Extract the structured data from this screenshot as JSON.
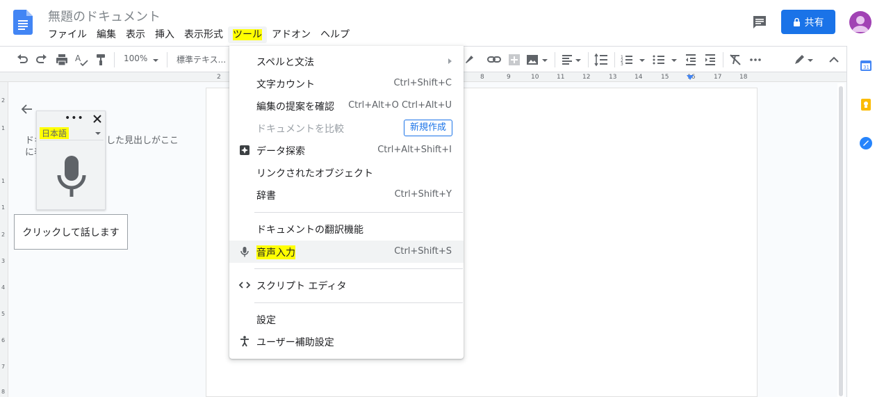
{
  "document": {
    "title": "無題のドキュメント"
  },
  "menubar": {
    "items": [
      "ファイル",
      "編集",
      "表示",
      "挿入",
      "表示形式",
      "ツール",
      "アドオン",
      "ヘルプ"
    ]
  },
  "header": {
    "share_label": "共有"
  },
  "toolbar": {
    "zoom": "100%",
    "style": "標準テキス..."
  },
  "ruler": {
    "marks": [
      "2",
      "8",
      "9",
      "10",
      "11",
      "12",
      "13",
      "14",
      "15",
      "16",
      "17",
      "18"
    ],
    "v_marks": [
      "2",
      "1",
      "1",
      "1",
      "2",
      "3",
      "4",
      "5",
      "6",
      "7",
      "8"
    ]
  },
  "outline": {
    "text_line1": "ドキュメントに追加した見出しがここ",
    "text_line2": "に表示されます。"
  },
  "voice_widget": {
    "language": "日本語",
    "dots": "•••",
    "tooltip": "クリックして話します"
  },
  "tools_menu": {
    "items": [
      {
        "label": "スペルと文法",
        "shortcut": ""
      },
      {
        "label": "文字カウント",
        "shortcut": "Ctrl+Shift+C"
      },
      {
        "label": "編集の提案を確認",
        "shortcut": "Ctrl+Alt+O Ctrl+Alt+U"
      },
      {
        "label": "ドキュメントを比較",
        "shortcut": ""
      },
      {
        "label": "データ探索",
        "shortcut": "Ctrl+Alt+Shift+I"
      },
      {
        "label": "リンクされたオブジェクト",
        "shortcut": ""
      },
      {
        "label": "辞書",
        "shortcut": "Ctrl+Shift+Y"
      },
      {
        "label": "ドキュメントの翻訳機能",
        "shortcut": ""
      },
      {
        "label": "音声入力",
        "shortcut": "Ctrl+Shift+S"
      },
      {
        "label": "スクリプト エディタ",
        "shortcut": ""
      },
      {
        "label": "設定",
        "shortcut": ""
      },
      {
        "label": "ユーザー補助設定",
        "shortcut": ""
      }
    ],
    "compare_new_label": "新規作成"
  },
  "colors": {
    "accent": "#1a73e8",
    "highlight": "#ffff00",
    "avatar": "#a142b4"
  }
}
